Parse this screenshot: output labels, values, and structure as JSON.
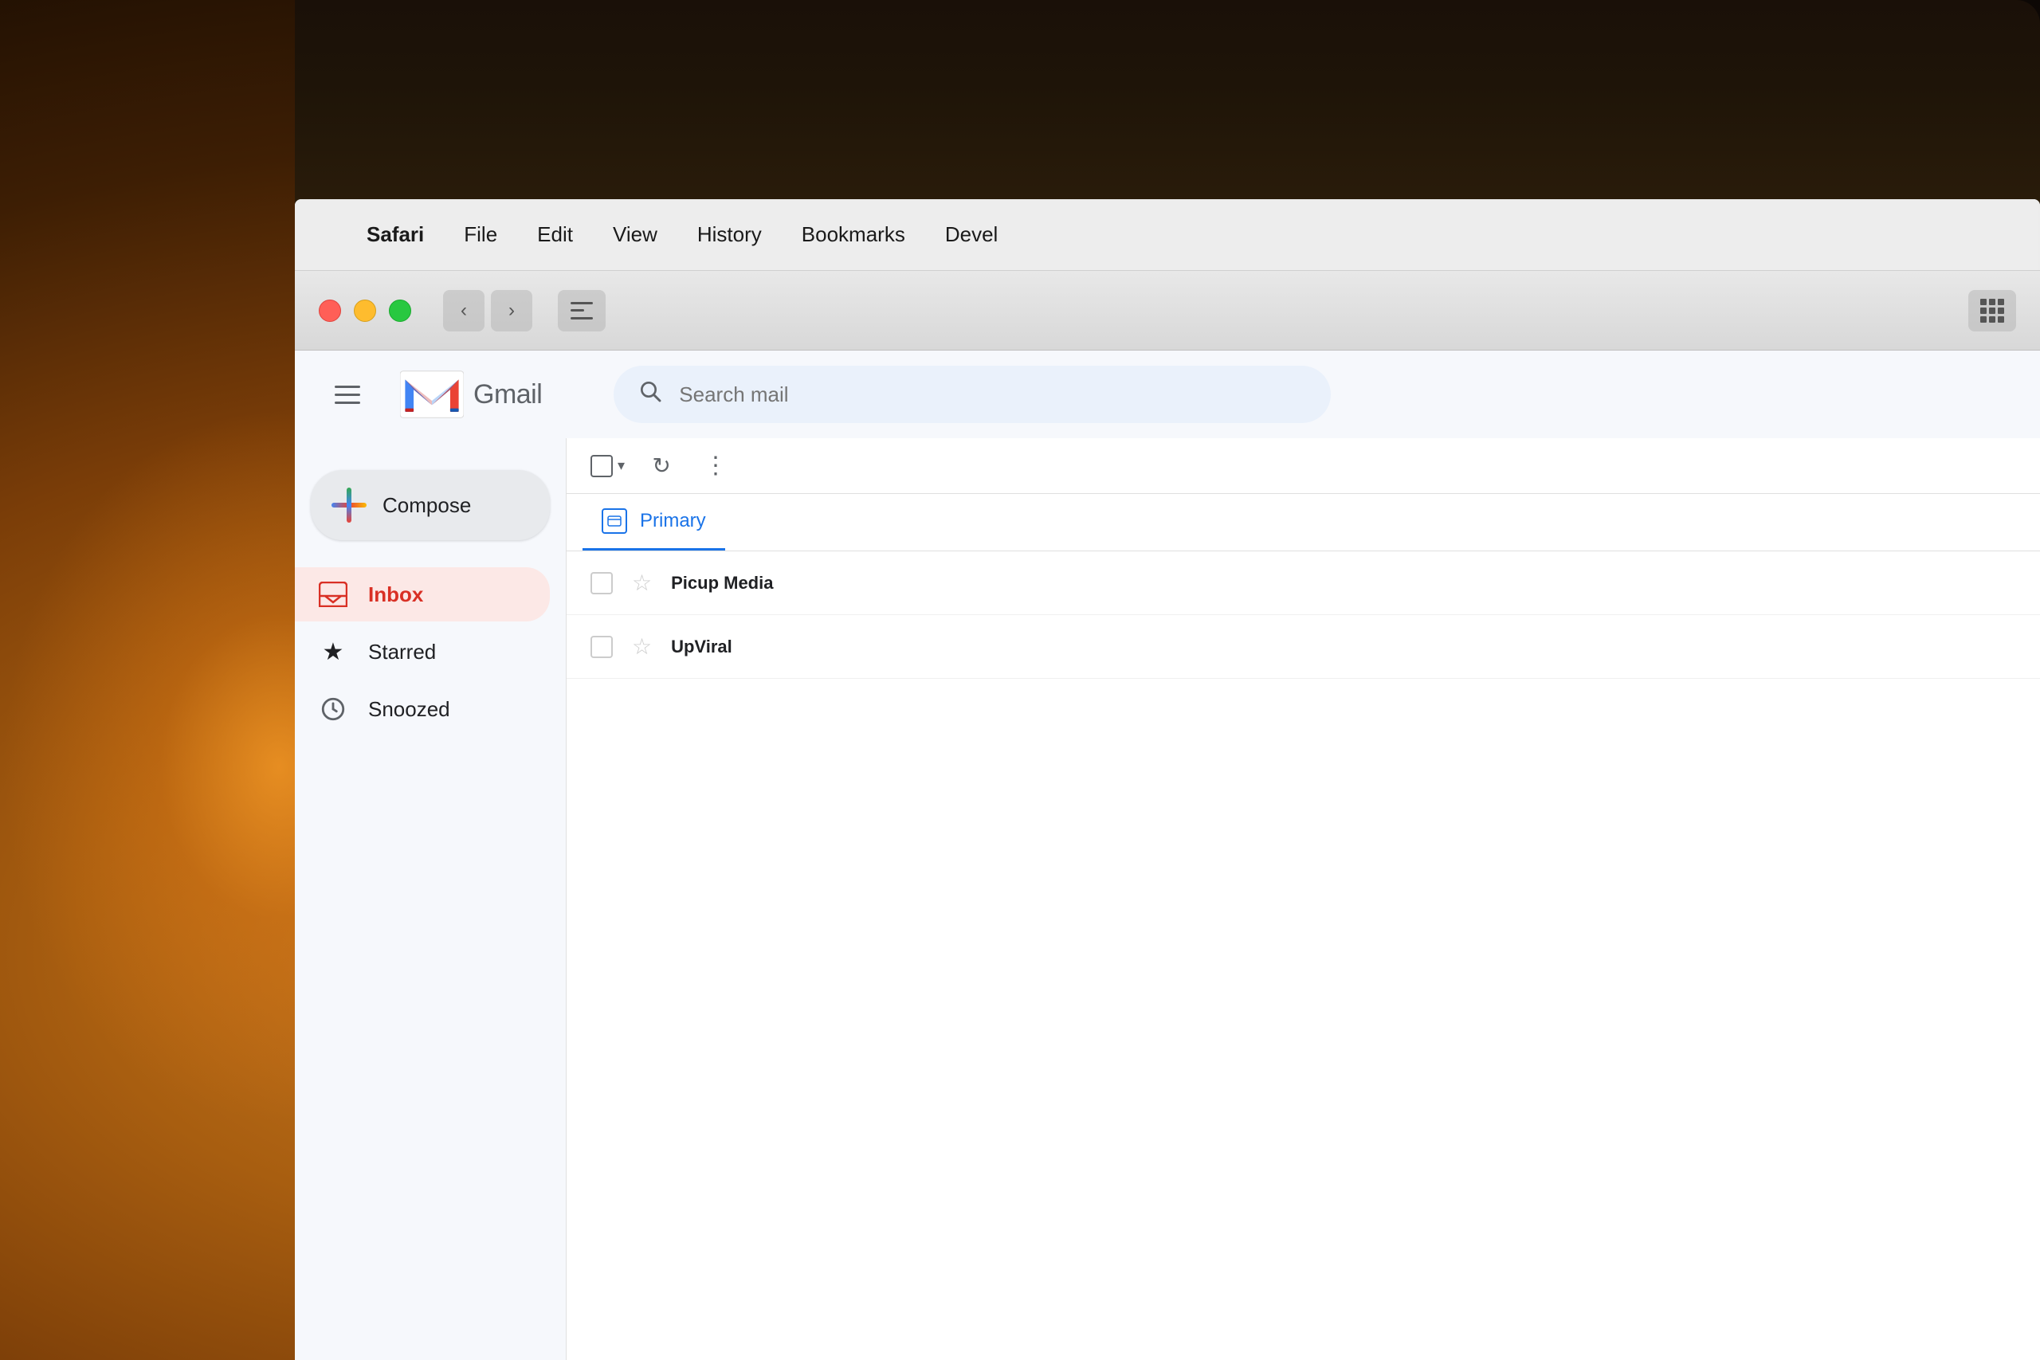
{
  "background": {
    "description": "Warm ambient photography background with glowing light fixture"
  },
  "macos": {
    "menubar": {
      "apple_symbol": "",
      "items": [
        {
          "label": "Safari",
          "bold": true
        },
        {
          "label": "File"
        },
        {
          "label": "Edit"
        },
        {
          "label": "View"
        },
        {
          "label": "History"
        },
        {
          "label": "Bookmarks"
        },
        {
          "label": "Devel"
        }
      ]
    },
    "browser": {
      "back_label": "‹",
      "forward_label": "›"
    }
  },
  "gmail": {
    "header": {
      "logo_text": "Gmail",
      "search_placeholder": "Search mail"
    },
    "sidebar": {
      "compose_label": "Compose",
      "nav_items": [
        {
          "id": "inbox",
          "label": "Inbox",
          "active": true
        },
        {
          "id": "starred",
          "label": "Starred",
          "active": false
        },
        {
          "id": "snoozed",
          "label": "Snoozed",
          "active": false
        }
      ]
    },
    "toolbar": {
      "select_all_label": "",
      "refresh_label": "↻",
      "more_label": "⋮"
    },
    "tabs": [
      {
        "id": "primary",
        "label": "Primary",
        "active": true
      }
    ],
    "email_rows": [
      {
        "sender": "Picup Media",
        "star": "☆"
      },
      {
        "sender": "UpViral",
        "star": "☆"
      }
    ]
  },
  "colors": {
    "gmail_red": "#ea4335",
    "gmail_blue": "#4285f4",
    "gmail_green": "#34a853",
    "gmail_yellow": "#fbbc05",
    "active_nav_bg": "#fce8e6",
    "active_nav_text": "#d93025",
    "primary_tab_color": "#1a73e8",
    "search_bg": "#eaf1fb"
  }
}
